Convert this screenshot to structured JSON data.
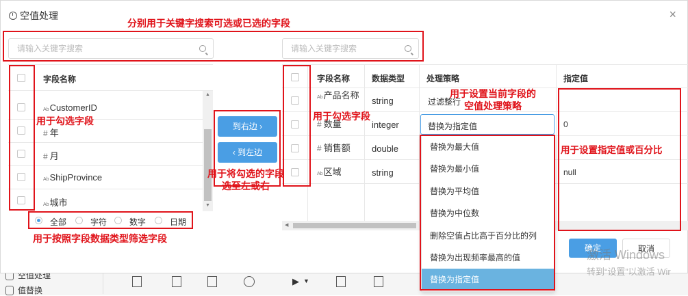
{
  "dialog": {
    "title": "空值处理",
    "close": "×",
    "confirm": "确定",
    "cancel": "取消"
  },
  "left": {
    "search_placeholder": "请输入关键字搜索",
    "header": "字段名称",
    "fields": [
      {
        "type": "Ab",
        "name": "CustomerID"
      },
      {
        "type": "#",
        "name": "年"
      },
      {
        "type": "#",
        "name": "月"
      },
      {
        "type": "Ab",
        "name": "ShipProvince"
      },
      {
        "type": "Ab",
        "name": "城市"
      }
    ],
    "filters": [
      "全部",
      "字符",
      "数字",
      "日期"
    ]
  },
  "transfer": {
    "to_right": "到右边 ›",
    "to_left": "‹ 到左边"
  },
  "right": {
    "search_placeholder": "请输入关键字搜索",
    "headers": [
      "字段名称",
      "数据类型",
      "处理策略",
      "指定值"
    ],
    "rows": [
      {
        "name_icon": "Ab",
        "name": "产品名称",
        "type": "string",
        "strategy": "过滤整行",
        "value": ""
      },
      {
        "name_icon": "#",
        "name": "数量",
        "type": "integer",
        "strategy": "替换为指定值",
        "value": "0"
      },
      {
        "name_icon": "#",
        "name": "销售额",
        "type": "double",
        "strategy": "",
        "value": ""
      },
      {
        "name_icon": "Ab",
        "name": "区域",
        "type": "string",
        "strategy": "",
        "value": "null"
      }
    ],
    "dropdown": [
      "替换为最大值",
      "替换为最小值",
      "替换为平均值",
      "替换为中位数",
      "删除空值占比高于百分比的列",
      "替换为出现频率最高的值",
      "替换为指定值"
    ],
    "dropdown_selected": "替换为指定值"
  },
  "annotations": {
    "top": "分别用于关键字搜索可选或已选的字段",
    "left_check": "用于勾选字段",
    "right_check": "用于勾选字段",
    "transfer": "用于将勾选的字段选至左或右",
    "strategy": "用于设置当前字段的空值处理策略",
    "value": "用于设置指定值或百分比",
    "filter": "用于按照字段数据类型筛选字段"
  },
  "background": {
    "menu_a": "空值处理",
    "menu_b": "值替换"
  },
  "watermark": {
    "line1": "激活 Windows",
    "line2": "转到“设置”以激活 Wir"
  },
  "colors": {
    "accent": "#4a9ee4",
    "annotation": "#e0131a",
    "selected_bg": "#6ab3e0"
  }
}
